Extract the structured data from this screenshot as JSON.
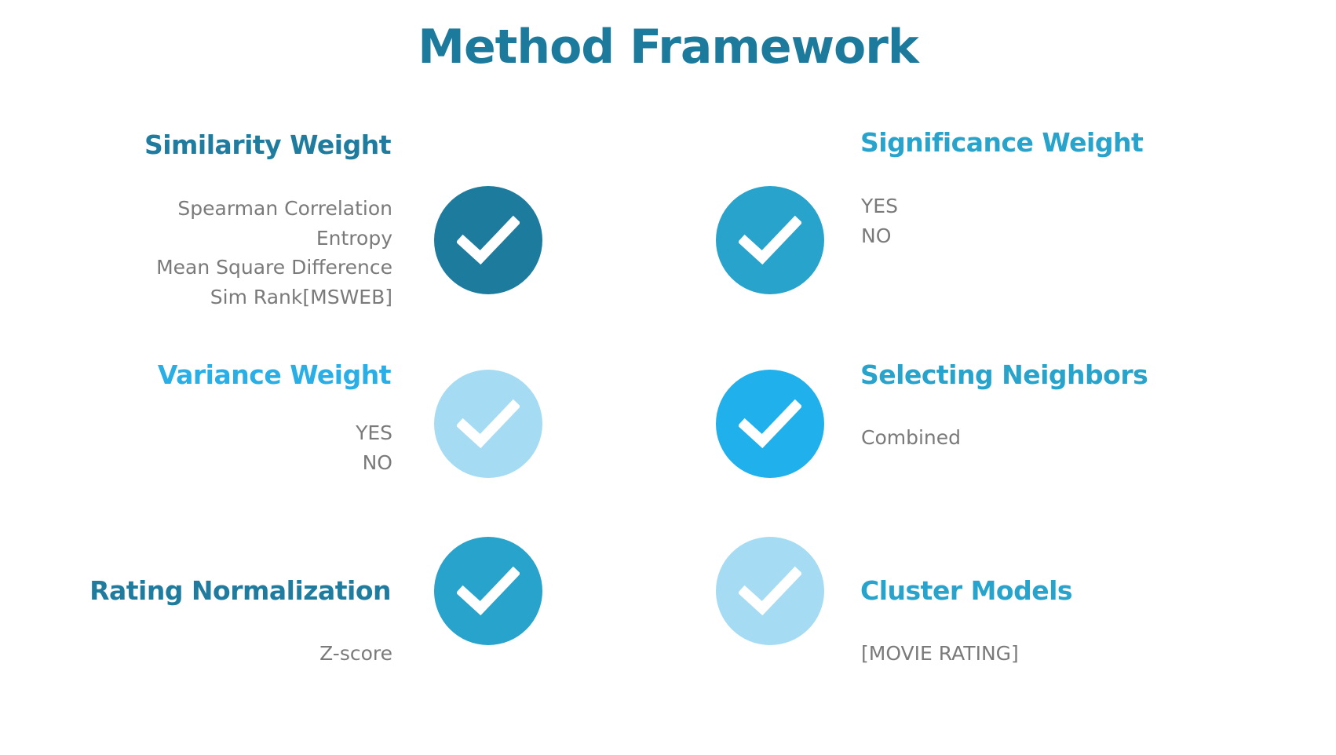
{
  "title": "Method Framework",
  "blocks": {
    "similarity": {
      "heading": "Similarity Weight",
      "options": [
        "Spearman Correlation",
        "Entropy",
        "Mean Square Difference",
        "Sim Rank[MSWEB]"
      ],
      "badge_icon": "check-icon",
      "badge_color": "#1d7c9d",
      "heading_color": "#1f7c9e"
    },
    "significance": {
      "heading": "Significance Weight",
      "options": [
        "YES",
        "NO"
      ],
      "badge_icon": "check-icon",
      "badge_color": "#28a3cc",
      "heading_color": "#28a3cc"
    },
    "variance": {
      "heading": "Variance Weight",
      "options": [
        "YES",
        "NO"
      ],
      "badge_icon": "check-icon",
      "badge_color": "#a6dcf3",
      "heading_color": "#29aee6"
    },
    "neighbors": {
      "heading": "Selecting Neighbors",
      "options": [
        "Combined"
      ],
      "badge_icon": "check-icon",
      "badge_color": "#20b0ec",
      "heading_color": "#28a3cc"
    },
    "normalization": {
      "heading": "Rating Normalization",
      "options": [
        "Z-score"
      ],
      "badge_icon": "check-icon",
      "badge_color": "#28a3cc",
      "heading_color": "#1f7c9e"
    },
    "cluster": {
      "heading": "Cluster Models",
      "options": [
        "[MOVIE RATING]"
      ],
      "badge_icon": "check-icon",
      "badge_color": "#a6dcf3",
      "heading_color": "#28a3cc"
    }
  }
}
